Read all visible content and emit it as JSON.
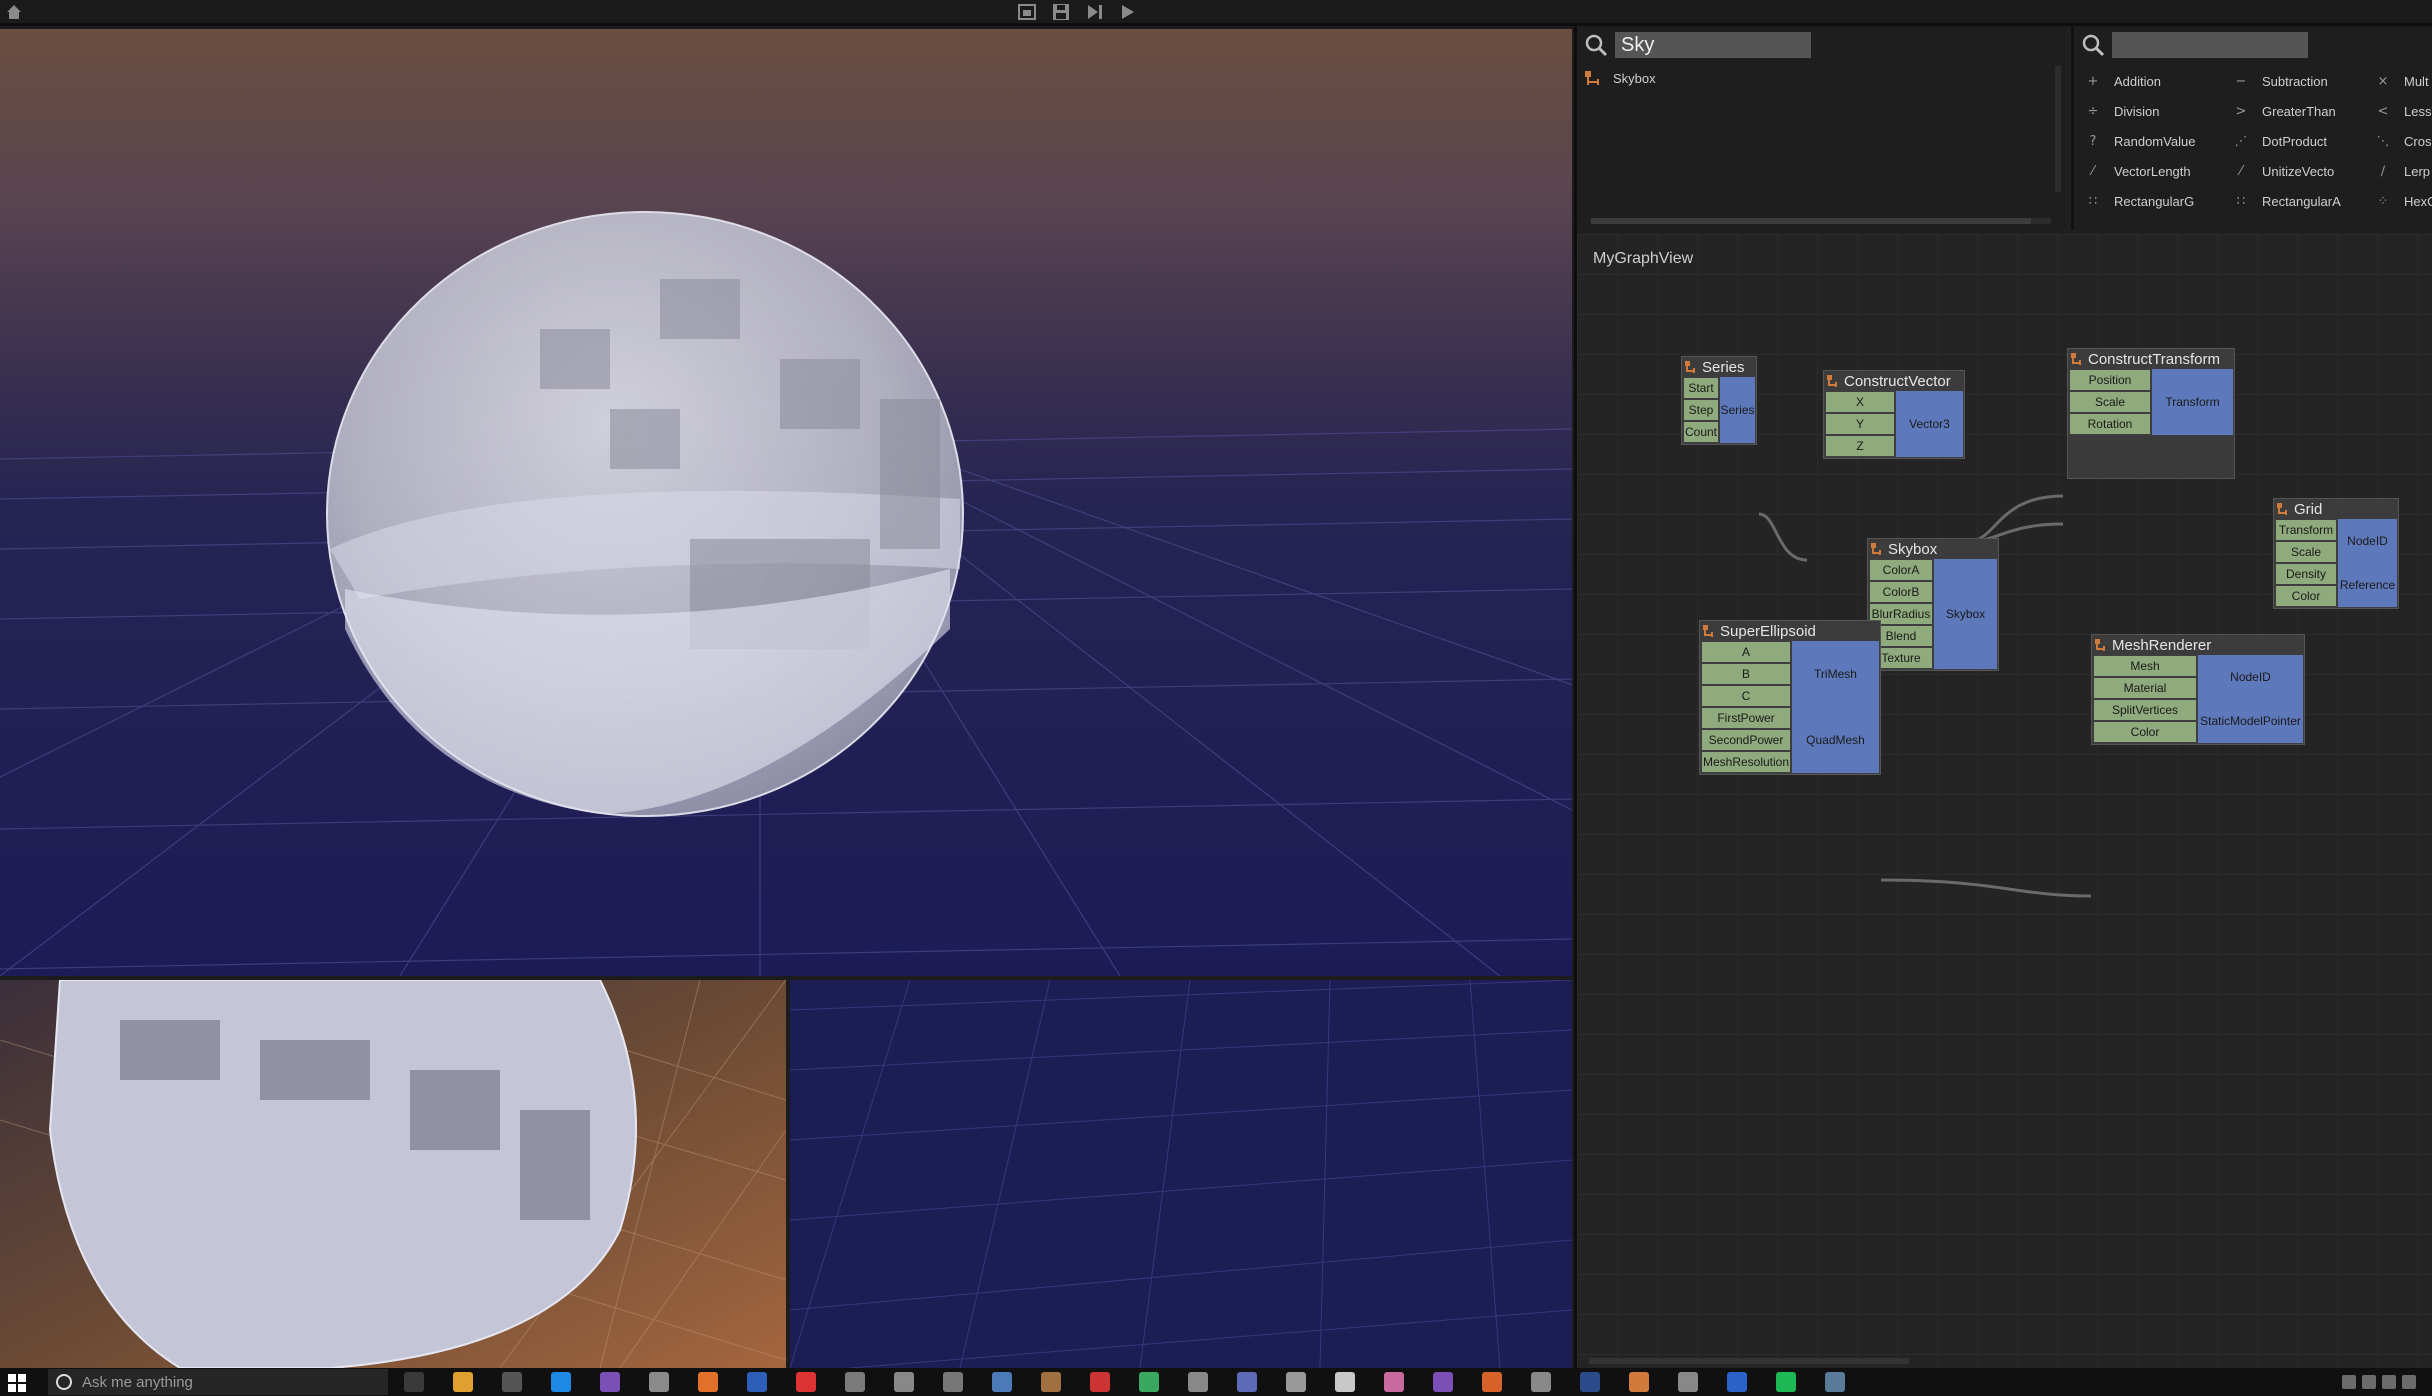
{
  "search_left": {
    "query": "Sky",
    "results": [
      {
        "label": "Skybox",
        "icon": "node-icon"
      }
    ]
  },
  "search_right": {
    "query": ""
  },
  "library": [
    {
      "label": "Addition",
      "glyph": "+",
      "icon": "addition-icon"
    },
    {
      "label": "Subtraction",
      "glyph": "−",
      "icon": "subtraction-icon"
    },
    {
      "label": "Mult",
      "glyph": "×",
      "icon": "multiplication-icon"
    },
    {
      "label": "Division",
      "glyph": "÷",
      "icon": "division-icon"
    },
    {
      "label": "GreaterThan",
      "glyph": ">",
      "icon": "greater-than-icon"
    },
    {
      "label": "LessT",
      "glyph": "<",
      "icon": "less-than-icon"
    },
    {
      "label": "RandomValue",
      "glyph": "?",
      "icon": "random-value-icon"
    },
    {
      "label": "DotProduct",
      "glyph": "⋰",
      "icon": "dot-product-icon"
    },
    {
      "label": "Cros",
      "glyph": "⋱",
      "icon": "cross-product-icon"
    },
    {
      "label": "VectorLength",
      "glyph": "⁄",
      "icon": "vector-length-icon"
    },
    {
      "label": "UnitizeVecto",
      "glyph": "⁄",
      "icon": "unitize-vector-icon"
    },
    {
      "label": "Lerp",
      "glyph": "∕",
      "icon": "lerp-icon"
    },
    {
      "label": "RectangularG",
      "glyph": "∷",
      "icon": "rectangular-grid-icon"
    },
    {
      "label": "RectangularA",
      "glyph": "∷",
      "icon": "rectangular-array-icon"
    },
    {
      "label": "HexG",
      "glyph": "⁘",
      "icon": "hex-grid-icon"
    }
  ],
  "graph": {
    "title": "MyGraphView",
    "nodes": [
      {
        "id": "series",
        "title": "Series",
        "inputs": [
          "Start",
          "Step",
          "Count"
        ],
        "outputs": [
          "Series"
        ]
      },
      {
        "id": "construct-vector",
        "title": "ConstructVector",
        "inputs": [
          "X",
          "Y",
          "Z"
        ],
        "outputs": [
          "Vector3"
        ]
      },
      {
        "id": "construct-transform",
        "title": "ConstructTransform",
        "inputs": [
          "Position",
          "Scale",
          "Rotation"
        ],
        "outputs": [
          "Transform"
        ]
      },
      {
        "id": "grid",
        "title": "Grid",
        "inputs": [
          "Transform",
          "Scale",
          "Density",
          "Color"
        ],
        "outputs": [
          "NodeID",
          "Reference"
        ]
      },
      {
        "id": "skybox",
        "title": "Skybox",
        "inputs": [
          "ColorA",
          "ColorB",
          "BlurRadius",
          "Blend",
          "Texture"
        ],
        "outputs": [
          "Skybox"
        ]
      },
      {
        "id": "super-ellipsoid",
        "title": "SuperEllipsoid",
        "inputs": [
          "A",
          "B",
          "C",
          "FirstPower",
          "SecondPower",
          "MeshResolution"
        ],
        "outputs": [
          "TriMesh",
          "QuadMesh"
        ]
      },
      {
        "id": "mesh-renderer",
        "title": "MeshRenderer",
        "inputs": [
          "Mesh",
          "Material",
          "SplitVertices",
          "Color"
        ],
        "outputs": [
          "NodeID",
          "StaticModelPointer"
        ]
      }
    ]
  },
  "taskbar": {
    "search_placeholder": "Ask me anything"
  },
  "colors": {
    "input_port": "#8faa7c",
    "output_port": "#5e79bb",
    "sky_top": "#7a5a45",
    "floor": "#1f1e55"
  }
}
